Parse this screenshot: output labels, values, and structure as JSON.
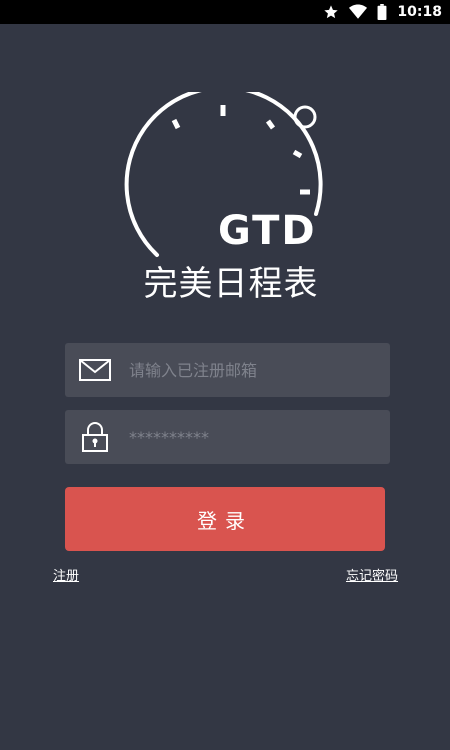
{
  "status_bar": {
    "time": "10:18",
    "icons": [
      "star-icon",
      "wifi-icon",
      "battery-icon"
    ]
  },
  "logo": {
    "badge_text": "GTD",
    "app_name": "完美日程表"
  },
  "form": {
    "email_placeholder": "请输入已注册邮箱",
    "email_value": "",
    "password_placeholder": "**********",
    "password_value": ""
  },
  "actions": {
    "login_label": "登录",
    "register_label": "注册",
    "forgot_label": "忘记密码"
  },
  "colors": {
    "background": "#333744",
    "field_background": "#494c57",
    "accent": "#d9544f",
    "placeholder": "#7f828c",
    "text": "#ffffff"
  }
}
